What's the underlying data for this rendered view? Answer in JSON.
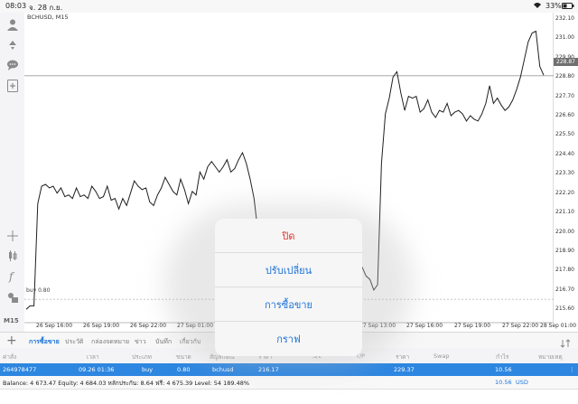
{
  "status_bar": {
    "time": "08:03",
    "date": "จ. 28 ก.ย.",
    "battery": "33%"
  },
  "chart": {
    "symbol_label": "BCHUSD, M15",
    "current_price": "228.87",
    "buy_line_label": "buy 0.80"
  },
  "chart_data": {
    "type": "line",
    "title": "BCHUSD, M15",
    "ylim": [
      215.0,
      232.3
    ],
    "y_ticks": [
      "232.10",
      "231.00",
      "229.90",
      "228.80",
      "227.70",
      "226.60",
      "225.50",
      "224.40",
      "223.30",
      "222.20",
      "221.10",
      "220.00",
      "218.90",
      "217.80",
      "216.70",
      "215.60"
    ],
    "x_ticks": [
      "26 Sep 16:00",
      "26 Sep 19:00",
      "26 Sep 22:00",
      "27 Sep 01:00",
      "27 Sep 13:00",
      "27 Sep 16:00",
      "27 Sep 19:00",
      "27 Sep 22:00",
      "28 Sep 01:00"
    ],
    "series": [
      {
        "values": [
          215.6,
          215.8,
          215.8,
          221.6,
          222.6,
          222.7,
          222.5,
          222.6,
          222.2,
          222.5,
          222.0,
          222.1,
          221.9,
          222.5,
          222.0,
          222.1,
          221.9,
          222.6,
          222.3,
          221.9,
          222.0,
          222.6,
          221.8,
          221.9,
          221.3,
          221.9,
          221.5,
          222.2,
          222.9,
          222.6,
          222.4,
          222.5,
          221.7,
          221.5,
          222.1,
          222.5,
          223.1,
          222.7,
          222.3,
          222.1,
          223.0,
          222.4,
          221.6,
          222.3,
          222.1,
          223.4,
          223.0,
          223.7,
          224.0,
          223.7,
          223.4,
          223.7,
          224.1,
          223.4,
          223.6,
          224.1,
          224.5,
          223.9,
          223.0,
          221.9,
          220.0,
          218.1,
          218.4,
          218.2,
          218.5,
          218.3,
          218.4,
          218.6,
          218.2,
          218.3,
          218.5,
          218.3,
          218.6,
          218.3,
          218.4,
          218.4,
          218.2,
          218.5,
          218.6,
          218.1,
          217.8,
          218.3,
          218.6,
          218.4,
          218.5,
          218.3,
          218.0,
          218.0,
          217.5,
          217.3,
          216.7,
          217.0,
          223.9,
          226.7,
          227.6,
          228.8,
          229.1,
          227.9,
          226.9,
          227.7,
          227.6,
          227.7,
          226.8,
          227.0,
          227.5,
          226.8,
          226.5,
          226.9,
          226.8,
          227.3,
          226.6,
          226.8,
          226.9,
          226.7,
          226.3,
          226.6,
          226.4,
          226.3,
          226.7,
          227.3,
          228.3,
          227.3,
          227.6,
          227.2,
          226.9,
          227.1,
          227.5,
          228.1,
          228.8,
          229.8,
          230.8,
          231.3,
          231.4,
          229.4,
          228.9
        ]
      }
    ]
  },
  "tabs": [
    "การซื้อขาย",
    "ประวัติ",
    "กล่องจดหมาย",
    "ข่าว",
    "บันทึก",
    "เกี่ยวกับ"
  ],
  "table": {
    "columns": [
      "ค่าสั่ง",
      "เวลา",
      "ประเภท",
      "ขนาด",
      "สัญลักษณ์",
      "ราคา",
      "S/L",
      "T/P",
      "ราคา",
      "Swap",
      "กำไร",
      "หมายเหตุ"
    ],
    "row": [
      "264978477",
      "09.26 01:36",
      "buy",
      "0.80",
      "bchusd",
      "216.17",
      "",
      "",
      "229.37",
      "",
      "10.56",
      ""
    ]
  },
  "balance": {
    "text": "Balance: 4 673.47 Equity: 4 684.03 หลักประกัน: 8.64 ฟรี: 4 675.39 Level: 54 189.48%",
    "profit": "10.56",
    "currency": "USD"
  },
  "context_menu": {
    "items": [
      "ปิด",
      "ปรับเปลี่ยน",
      "การซื้อขาย",
      "กราฟ"
    ]
  },
  "sidebar": {
    "timeframe": "M15"
  },
  "colors": {
    "accent": "#1a73d9",
    "danger": "#e0352b",
    "selected_row": "#2d86e0"
  }
}
